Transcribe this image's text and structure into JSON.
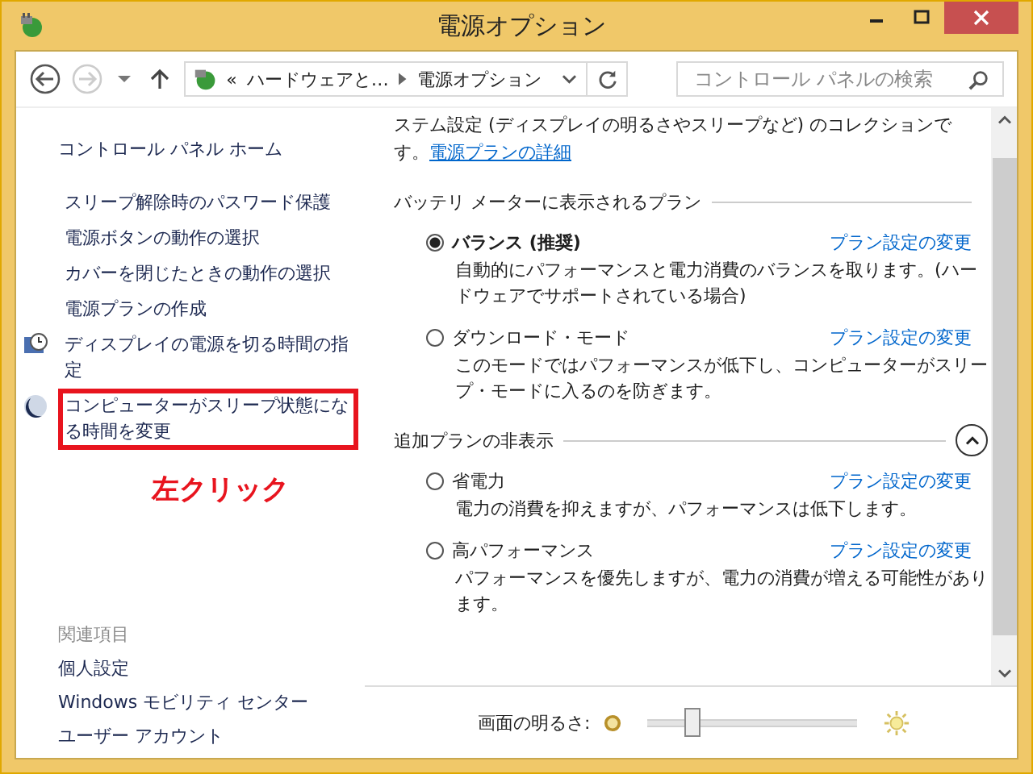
{
  "window": {
    "title": "電源オプション"
  },
  "address_bar": {
    "overflow": "«",
    "path": [
      "ハードウェアと…",
      "電源オプション"
    ]
  },
  "search": {
    "placeholder": "コントロール パネルの検索"
  },
  "sidebar": {
    "home": "コントロール パネル ホーム",
    "links": [
      {
        "label": "スリープ解除時のパスワード保護",
        "kind": "text",
        "highlighted": false
      },
      {
        "label": "電源ボタンの動作の選択",
        "kind": "text",
        "highlighted": false
      },
      {
        "label": "カバーを閉じたときの動作の選択",
        "kind": "text",
        "highlighted": false
      },
      {
        "label": "電源プランの作成",
        "kind": "text",
        "highlighted": false
      },
      {
        "label": "ディスプレイの電源を切る時間の指定",
        "kind": "display",
        "highlighted": false
      },
      {
        "label": "コンピューターがスリープ状態になる時間を変更",
        "kind": "sleep",
        "highlighted": true
      }
    ],
    "annotation": "左クリック",
    "related_heading": "関連項目",
    "related": [
      "個人設定",
      "Windows モビリティ センター",
      "ユーザー アカウント"
    ]
  },
  "intro": {
    "text": "ステム設定 (ディスプレイの明るさやスリープなど) のコレクションです。",
    "link": "電源プランの詳細"
  },
  "sections": [
    {
      "heading": "バッテリ メーターに表示されるプラン",
      "collapsible": false,
      "plans": [
        {
          "name": "バランス (推奨)",
          "selected": true,
          "link": "プラン設定の変更",
          "description": "自動的にパフォーマンスと電力消費のバランスを取ります。(ハードウェアでサポートされている場合)"
        },
        {
          "name": "ダウンロード・モード",
          "selected": false,
          "link": "プラン設定の変更",
          "description": "このモードではパフォーマンスが低下し、コンピューターがスリープ・モードに入るのを防ぎます。"
        }
      ]
    },
    {
      "heading": "追加プランの非表示",
      "collapsible": true,
      "plans": [
        {
          "name": "省電力",
          "selected": false,
          "link": "プラン設定の変更",
          "description": "電力の消費を抑えますが、パフォーマンスは低下します。"
        },
        {
          "name": "高パフォーマンス",
          "selected": false,
          "link": "プラン設定の変更",
          "description": "パフォーマンスを優先しますが、電力の消費が増える可能性があります。"
        }
      ]
    }
  ],
  "brightness": {
    "label": "画面の明るさ:",
    "level": 0.22
  }
}
